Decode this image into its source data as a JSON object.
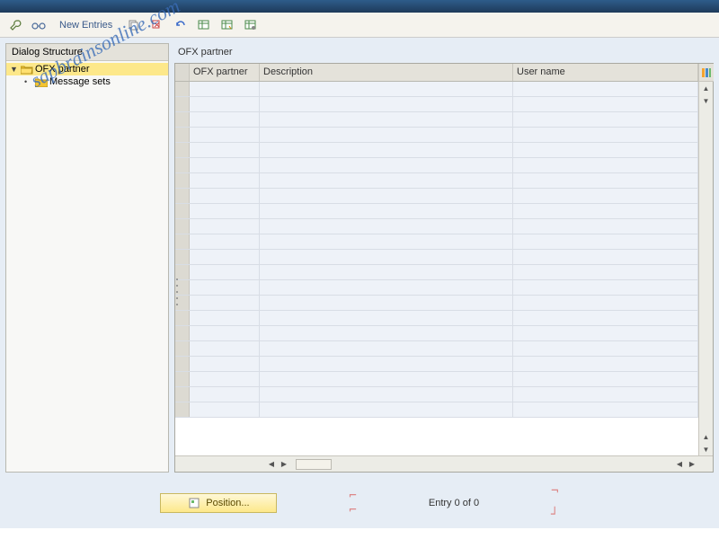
{
  "toolbar": {
    "new_entries_label": "New Entries"
  },
  "left_panel": {
    "header": "Dialog Structure",
    "tree": [
      {
        "label": "OFX partner",
        "selected": true,
        "level": 0,
        "expanded": true
      },
      {
        "label": "Message sets",
        "selected": false,
        "level": 1,
        "expanded": false
      }
    ]
  },
  "right_panel": {
    "section_title": "OFX partner",
    "columns": [
      "OFX partner",
      "Description",
      "User name"
    ],
    "empty_row_count": 22
  },
  "footer": {
    "position_label": "Position...",
    "entry_text": "Entry 0 of 0"
  },
  "watermark": "sapbrainsonline.com",
  "icons": {
    "wrench": "wrench-icon",
    "glasses": "glasses-icon",
    "copy": "copy-icon",
    "scissors": "scissors-icon",
    "undo": "undo-icon",
    "table1": "table-icon",
    "table2": "table-export-icon",
    "table3": "table-settings-icon",
    "config_col": "configure-columns-icon",
    "pos": "position-icon"
  }
}
